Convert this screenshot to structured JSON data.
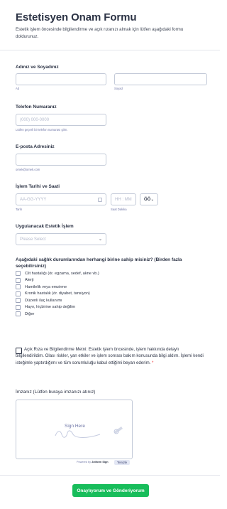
{
  "header": {
    "title": "Estetisyen Onam Formu",
    "subtitle": "Estetik işlem öncesinde bilgilendirme ve açık rızanızı almak için lütfen aşağıdaki formu doldurunuz."
  },
  "name": {
    "label": "Adınız ve Soyadınız",
    "first_sub": "Ad",
    "last_sub": "Soyad"
  },
  "phone": {
    "label": "Telefon Numaranız",
    "placeholder": "(000) 000-0000",
    "sub": "Lütfen geçerli bir telefon numarası girin."
  },
  "email": {
    "label": "E-posta Adresiniz",
    "sub": "ornek@ornek.com"
  },
  "datetime": {
    "label": "İşlem Tarihi ve Saati",
    "date_placeholder": "AA-GG-YYYY",
    "date_sub": "Tarih",
    "time_placeholder": "HH : MM",
    "time_sub": "Saat Dakika",
    "ampm_value": "ÖÖ"
  },
  "procedure": {
    "label": "Uygulanacak Estetik İşlem",
    "selected": "Please Select"
  },
  "health": {
    "label": "Aşağıdaki sağlık durumlarından herhangi birine sahip misiniz? (Birden fazla seçebilirsiniz)",
    "options": [
      "Cilt hastalığı (ör. egzama, sedef, akne vb.)",
      "Alerji",
      "Hamilelik veya emzirme",
      "Kronik hastalık (ör. diyabet, tansiyon)",
      "Düzenli ilaç kullanımı",
      "Hayır, hiçbirine sahip değilim",
      "Diğer"
    ]
  },
  "consent": {
    "text": "Açık Rıza ve Bilgilendirme Metni: Estetik işlem öncesinde, işlem hakkında detaylı bilgilendirildim. Olası riskler, yan etkiler ve işlem sonrası bakım konusunda bilgi aldım. İşlemi kendi isteğimle yaptırdığımı ve tüm sorumluluğu kabul ettiğimi beyan ederim.",
    "required_mark": "*"
  },
  "signature": {
    "label": "İmzanız (Lütfen buraya imzanızı atınız)",
    "placeholder": "Sign Here",
    "powered_by": "Powered by",
    "brand": "Jotform Sign",
    "clear_label": "Temizle"
  },
  "submit": {
    "label": "Onaylıyorum ve Gönderiyorum"
  },
  "colors": {
    "accent": "#18bd5b",
    "required": "#f23a3c",
    "text": "#2c3345",
    "muted": "#6f76a7"
  }
}
